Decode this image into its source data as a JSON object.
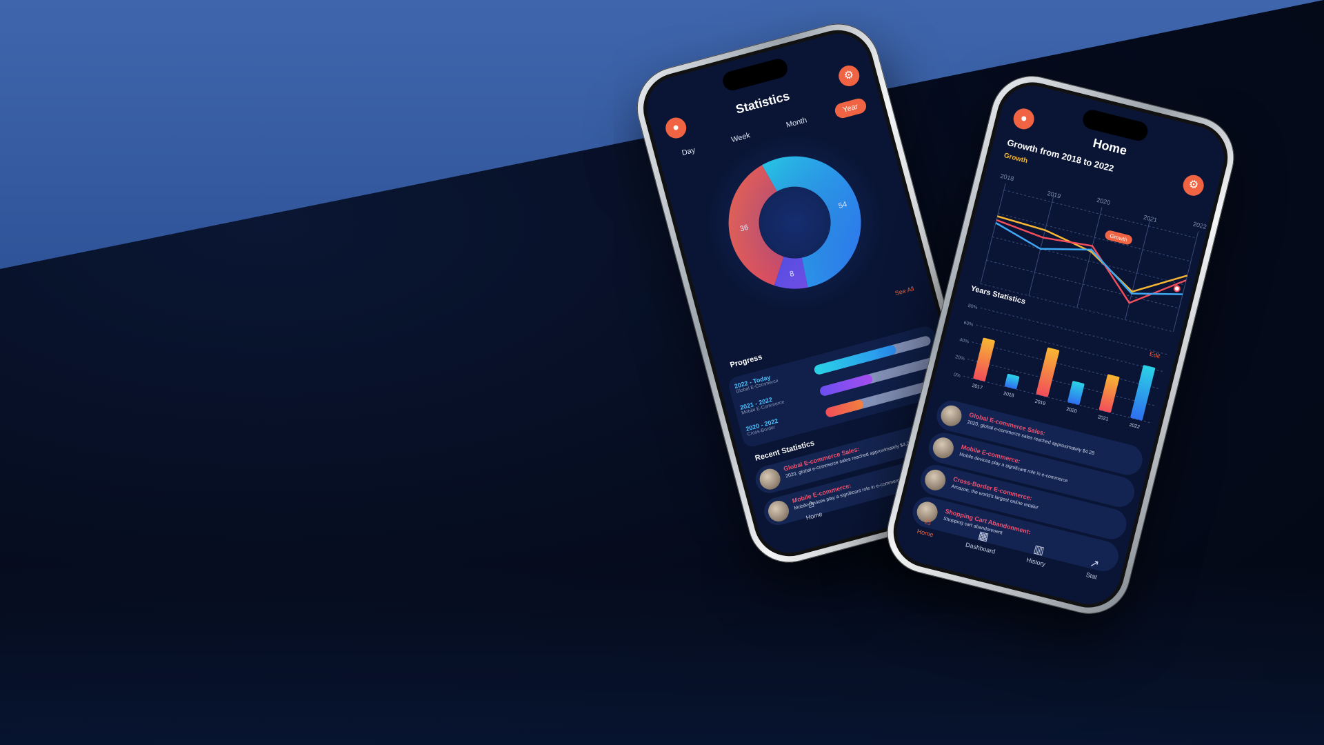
{
  "statistics_screen": {
    "title": "Statistics",
    "tabs": [
      "Day",
      "Week",
      "Month",
      "Year"
    ],
    "active_tab": "Year",
    "donut": {
      "segments": [
        {
          "value": 54,
          "label": "54",
          "color_from": "#27d0e6",
          "color_to": "#2f6ff0"
        },
        {
          "value": 8,
          "label": "8",
          "color_from": "#5a4fe6",
          "color_to": "#7a4ce8"
        },
        {
          "value": 36,
          "label": "36",
          "color_from": "#f2694a",
          "color_to": "#e8435a"
        }
      ]
    },
    "see_all": "See All",
    "progress": {
      "heading": "Progress",
      "rows": [
        {
          "range": "2022 - Today",
          "sub": "Global E-Commerce",
          "fraction": 0.7,
          "color_from": "#2ad3e6",
          "color_to": "#2b8cf0"
        },
        {
          "range": "2021 - 2022",
          "sub": "Mobile E-Commerce",
          "fraction": 0.45,
          "color_from": "#6b4ef0",
          "color_to": "#a64ff0"
        },
        {
          "range": "2020 - 2022",
          "sub": "Cross-Border",
          "fraction": 0.32,
          "color_from": "#f24d5a",
          "color_to": "#f2823f"
        }
      ]
    },
    "recent": {
      "heading": "Recent Statistics",
      "items": [
        {
          "title": "Global E-commerce Sales:",
          "desc": "2020, global e-commerce sales reached approximately $4.28"
        },
        {
          "title": "Mobile E-commerce:",
          "desc": "Mobile devices play a significant role in e-commerce"
        }
      ]
    },
    "nav": [
      {
        "label": "Home",
        "icon": "home-icon",
        "glyph": "⌂",
        "active": false
      },
      {
        "label": "Dashboard",
        "icon": "dashboard-icon",
        "glyph": "▦",
        "active": true
      }
    ]
  },
  "home_screen": {
    "title": "Home",
    "subtitle": "Growth from 2018 to 2022",
    "line_chart_label": "Growth",
    "line_tooltip": "Growth",
    "bar_chart_title": "Years Statistics",
    "edit_label": "Edit",
    "list": [
      {
        "title": "Global E-commerce Sales:",
        "desc": "2020, global e-commerce sales reached approximately $4.28"
      },
      {
        "title": "Mobile E-commerce:",
        "desc": "Mobile devices play a significant role in e-commerce"
      },
      {
        "title": "Cross-Border E-commerce:",
        "desc": "Amazon, the world's largest online retailer"
      },
      {
        "title": "Shopping Cart Abandonment:",
        "desc": "Shopping cart abandonment"
      }
    ],
    "nav": [
      {
        "label": "Home",
        "icon": "home-icon",
        "glyph": "⌂",
        "active": true
      },
      {
        "label": "Dashboard",
        "icon": "dashboard-icon",
        "glyph": "▦",
        "active": false
      },
      {
        "label": "History",
        "icon": "history-icon",
        "glyph": "▥",
        "active": false
      },
      {
        "label": "Stat",
        "icon": "trend-icon",
        "glyph": "↗",
        "active": false
      }
    ]
  },
  "chart_data": [
    {
      "type": "line",
      "title": "Growth",
      "x": [
        "2018",
        "2019",
        "2020",
        "2021",
        "2022"
      ],
      "ylim": [
        0,
        100
      ],
      "series": [
        {
          "color": "#f7b733",
          "values": [
            72,
            70,
            60,
            30,
            60
          ]
        },
        {
          "color": "#f24d5a",
          "values": [
            68,
            62,
            66,
            18,
            55
          ]
        },
        {
          "color": "#3fa9f5",
          "values": [
            65,
            50,
            62,
            28,
            40
          ]
        }
      ],
      "grid": true
    },
    {
      "type": "bar",
      "title": "Years Statistics",
      "categories": [
        "2017",
        "2018",
        "2019",
        "2020",
        "2021",
        "2022"
      ],
      "values": [
        48,
        15,
        55,
        25,
        42,
        62
      ],
      "y_ticks": [
        "0%",
        "20%",
        "40%",
        "60%",
        "80%"
      ],
      "ylim": [
        0,
        80
      ],
      "bar_colors": [
        "warm",
        "cool",
        "warm",
        "cool",
        "warm",
        "cool"
      ],
      "grid": true
    }
  ]
}
